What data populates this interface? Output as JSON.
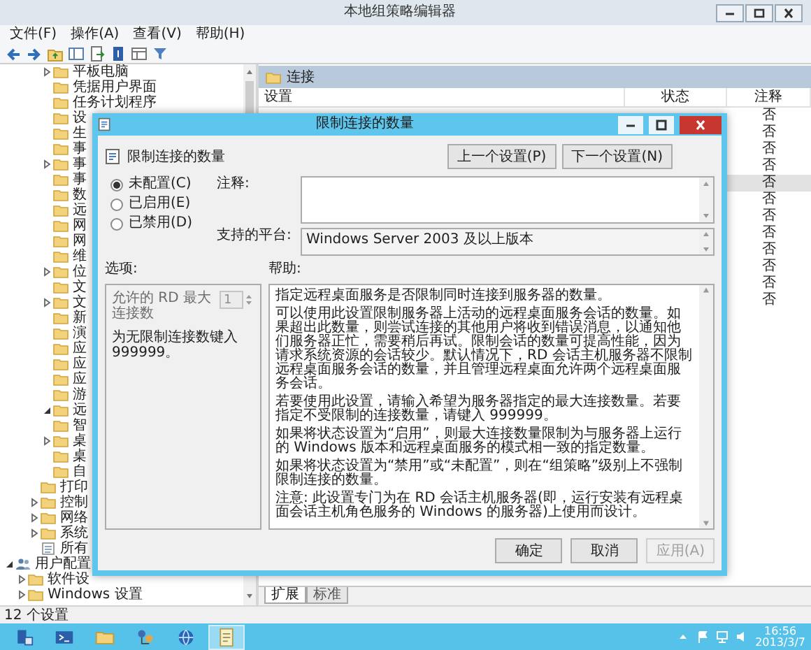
{
  "window": {
    "title": "本地组策略编辑器"
  },
  "menu": [
    "文件(F)",
    "操作(A)",
    "查看(V)",
    "帮助(H)"
  ],
  "tree": [
    {
      "children": [
        {
          "children": [
            {
              "children": [
                {
                  "label": "平板电脑",
                  "kind": "folder",
                  "expanded": false
                },
                {
                  "label": "凭据用户界面",
                  "kind": "folder"
                },
                {
                  "label": "任务计划程序",
                  "kind": "folder"
                },
                {
                  "label": "设",
                  "kind": "folder"
                },
                {
                  "label": "生",
                  "kind": "folder"
                },
                {
                  "label": "事",
                  "kind": "folder"
                },
                {
                  "label": "事",
                  "kind": "folder",
                  "expanded": false
                },
                {
                  "label": "事",
                  "kind": "folder"
                },
                {
                  "label": "数",
                  "kind": "folder"
                },
                {
                  "label": "远",
                  "kind": "folder"
                },
                {
                  "label": "网",
                  "kind": "folder"
                },
                {
                  "label": "网",
                  "kind": "folder"
                },
                {
                  "label": "维",
                  "kind": "folder"
                },
                {
                  "label": "位",
                  "kind": "folder",
                  "expanded": false
                },
                {
                  "label": "文",
                  "kind": "folder"
                },
                {
                  "label": "文",
                  "kind": "folder",
                  "expanded": false
                },
                {
                  "label": "新",
                  "kind": "folder"
                },
                {
                  "label": "演",
                  "kind": "folder"
                },
                {
                  "label": "应",
                  "kind": "folder"
                },
                {
                  "label": "应",
                  "kind": "folder"
                },
                {
                  "label": "应",
                  "kind": "folder"
                },
                {
                  "label": "游",
                  "kind": "folder"
                },
                {
                  "label": "远",
                  "kind": "folder",
                  "expanded": true
                },
                {
                  "label": "智",
                  "kind": "folder"
                },
                {
                  "label": "桌",
                  "kind": "folder",
                  "expanded": false
                },
                {
                  "label": "桌",
                  "kind": "folder"
                },
                {
                  "label": "自",
                  "kind": "folder"
                }
              ]
            },
            {
              "label": "打印",
              "kind": "folder"
            },
            {
              "label": "控制",
              "kind": "folder",
              "expanded": false
            },
            {
              "label": "网络",
              "kind": "folder",
              "expanded": false
            },
            {
              "label": "系统",
              "kind": "folder",
              "expanded": false
            },
            {
              "label": "所有",
              "kind": "settings"
            }
          ]
        }
      ]
    },
    {
      "label": "用户配置",
      "kind": "user",
      "expanded": true,
      "children": [
        {
          "label": "软件设",
          "kind": "folder",
          "expanded": false
        },
        {
          "label": "Windows 设置",
          "kind": "folder",
          "expanded": false
        }
      ]
    }
  ],
  "panel": {
    "title": "连接",
    "columns": [
      "设置",
      "状态",
      "注释"
    ],
    "rows": [
      {
        "comment": "否",
        "selected": false
      },
      {
        "comment": "否",
        "selected": false
      },
      {
        "comment": "否",
        "selected": false
      },
      {
        "comment": "否",
        "selected": false
      },
      {
        "comment": "否",
        "selected": true
      },
      {
        "comment": "否",
        "selected": false
      },
      {
        "comment": "否",
        "selected": false
      },
      {
        "comment": "否",
        "selected": false
      },
      {
        "comment": "否",
        "selected": false
      },
      {
        "comment": "否",
        "selected": false
      },
      {
        "comment": "否",
        "selected": false
      },
      {
        "comment": "否",
        "selected": false
      }
    ]
  },
  "bottom_tabs": [
    {
      "label": "扩展",
      "selected": true
    },
    {
      "label": "标准",
      "selected": false
    }
  ],
  "status_bar": "12 个设置",
  "dialog": {
    "title": "限制连接的数量",
    "heading": "限制连接的数量",
    "prev_button": "上一个设置(P)",
    "next_button": "下一个设置(N)",
    "radios": [
      {
        "label": "未配置(C)",
        "selected": true
      },
      {
        "label": "已启用(E)",
        "selected": false
      },
      {
        "label": "已禁用(D)",
        "selected": false
      }
    ],
    "comment_label": "注释:",
    "platform_label": "支持的平台:",
    "platform": "Windows Server 2003 及以上版本",
    "options_label": "选项:",
    "help_label": "帮助:",
    "option": {
      "label": "允许的 RD 最大连接数",
      "value": "1",
      "disabled": true
    },
    "option_hint": "为无限制连接数键入 999999。",
    "help": [
      "指定远程桌面服务是否限制同时连接到服务器的数量。",
      "可以使用此设置限制服务器上活动的远程桌面服务会话的数量。如果超出此数量，则尝试连接的其他用户将收到错误消息，以通知他们服务器正忙，需要稍后再试。限制会话的数量可提高性能，因为请求系统资源的会话较少。默认情况下，RD 会话主机服务器不限制远程桌面服务会话的数量，并且管理远程桌面允许两个远程桌面服务会话。",
      "若要使用此设置，请输入希望为服务器指定的最大连接数量。若要指定不受限制的连接数量，请键入 999999。",
      "如果将状态设置为“启用”，则最大连接数量限制为与服务器上运行的 Windows 版本和远程桌面服务的模式相一致的指定数量。",
      "如果将状态设置为“禁用”或“未配置”，则在“组策略”级别上不强制限制连接的数量。",
      "注意: 此设置专门为在 RD 会话主机服务器(即，运行安装有远程桌面会话主机角色服务的 Windows 的服务器)上使用而设计。"
    ],
    "buttons": [
      {
        "label": "确定",
        "disabled": false
      },
      {
        "label": "取消",
        "disabled": false
      },
      {
        "label": "应用(A)",
        "disabled": true
      }
    ]
  },
  "taskbar": {
    "apps": [
      {
        "kind": "server",
        "selected": false
      },
      {
        "kind": "shell",
        "selected": false
      },
      {
        "kind": "folder",
        "selected": false
      },
      {
        "kind": "network",
        "selected": false
      },
      {
        "kind": "globe",
        "selected": false
      },
      {
        "kind": "editor",
        "selected": true
      }
    ],
    "time": "16:56",
    "date": "2013/3/7"
  }
}
